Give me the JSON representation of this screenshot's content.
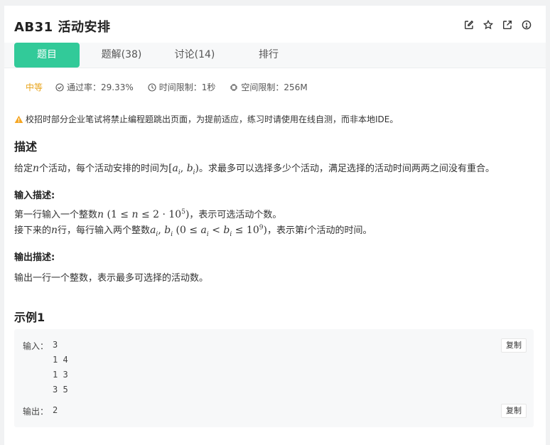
{
  "problem": {
    "title": "AB31  活动安排"
  },
  "tabs": [
    {
      "label": "题目",
      "active": true
    },
    {
      "label": "题解(38)"
    },
    {
      "label": "讨论(14)"
    },
    {
      "label": "排行"
    }
  ],
  "meta": {
    "level": "中等",
    "pass_rate": "通过率：29.33%",
    "time_limit": "时间限制：1秒",
    "space_limit": "空间限制：256M"
  },
  "notice": "校招时部分企业笔试将禁止编程题跳出页面，为提前适应，练习时请使用在线自测，而非本地IDE。",
  "description": {
    "heading": "描述",
    "text_before": "给定",
    "var_n": "n",
    "text_mid": "个活动，每个活动安排的时间为",
    "interval": "[a_i, b_i)",
    "text_after": "。求最多可以选择多少个活动，满足选择的活动时间两两之间没有重合。"
  },
  "input_desc": {
    "heading": "输入描述:",
    "line1_before": "第一行输入一个整数",
    "line1_after": "，表示可选活动个数。",
    "line2_before": "接下来的",
    "line2_mid": "行，每行输入两个整数",
    "line2_after": "，表示第",
    "line2_end": "个活动的时间。"
  },
  "output_desc": {
    "heading": "输出描述:",
    "text": "输出一行一个整数，表示最多可选择的活动数。"
  },
  "example": {
    "heading": "示例1",
    "input_label": "输入：",
    "input_lines": [
      "3",
      "1 4",
      "1 3",
      "3 5"
    ],
    "output_label": "输出：",
    "output": "2",
    "copy_label": "复制"
  },
  "colors": {
    "accent": "#32ca99",
    "level": "#e8a318",
    "warning": "#f5a623"
  }
}
